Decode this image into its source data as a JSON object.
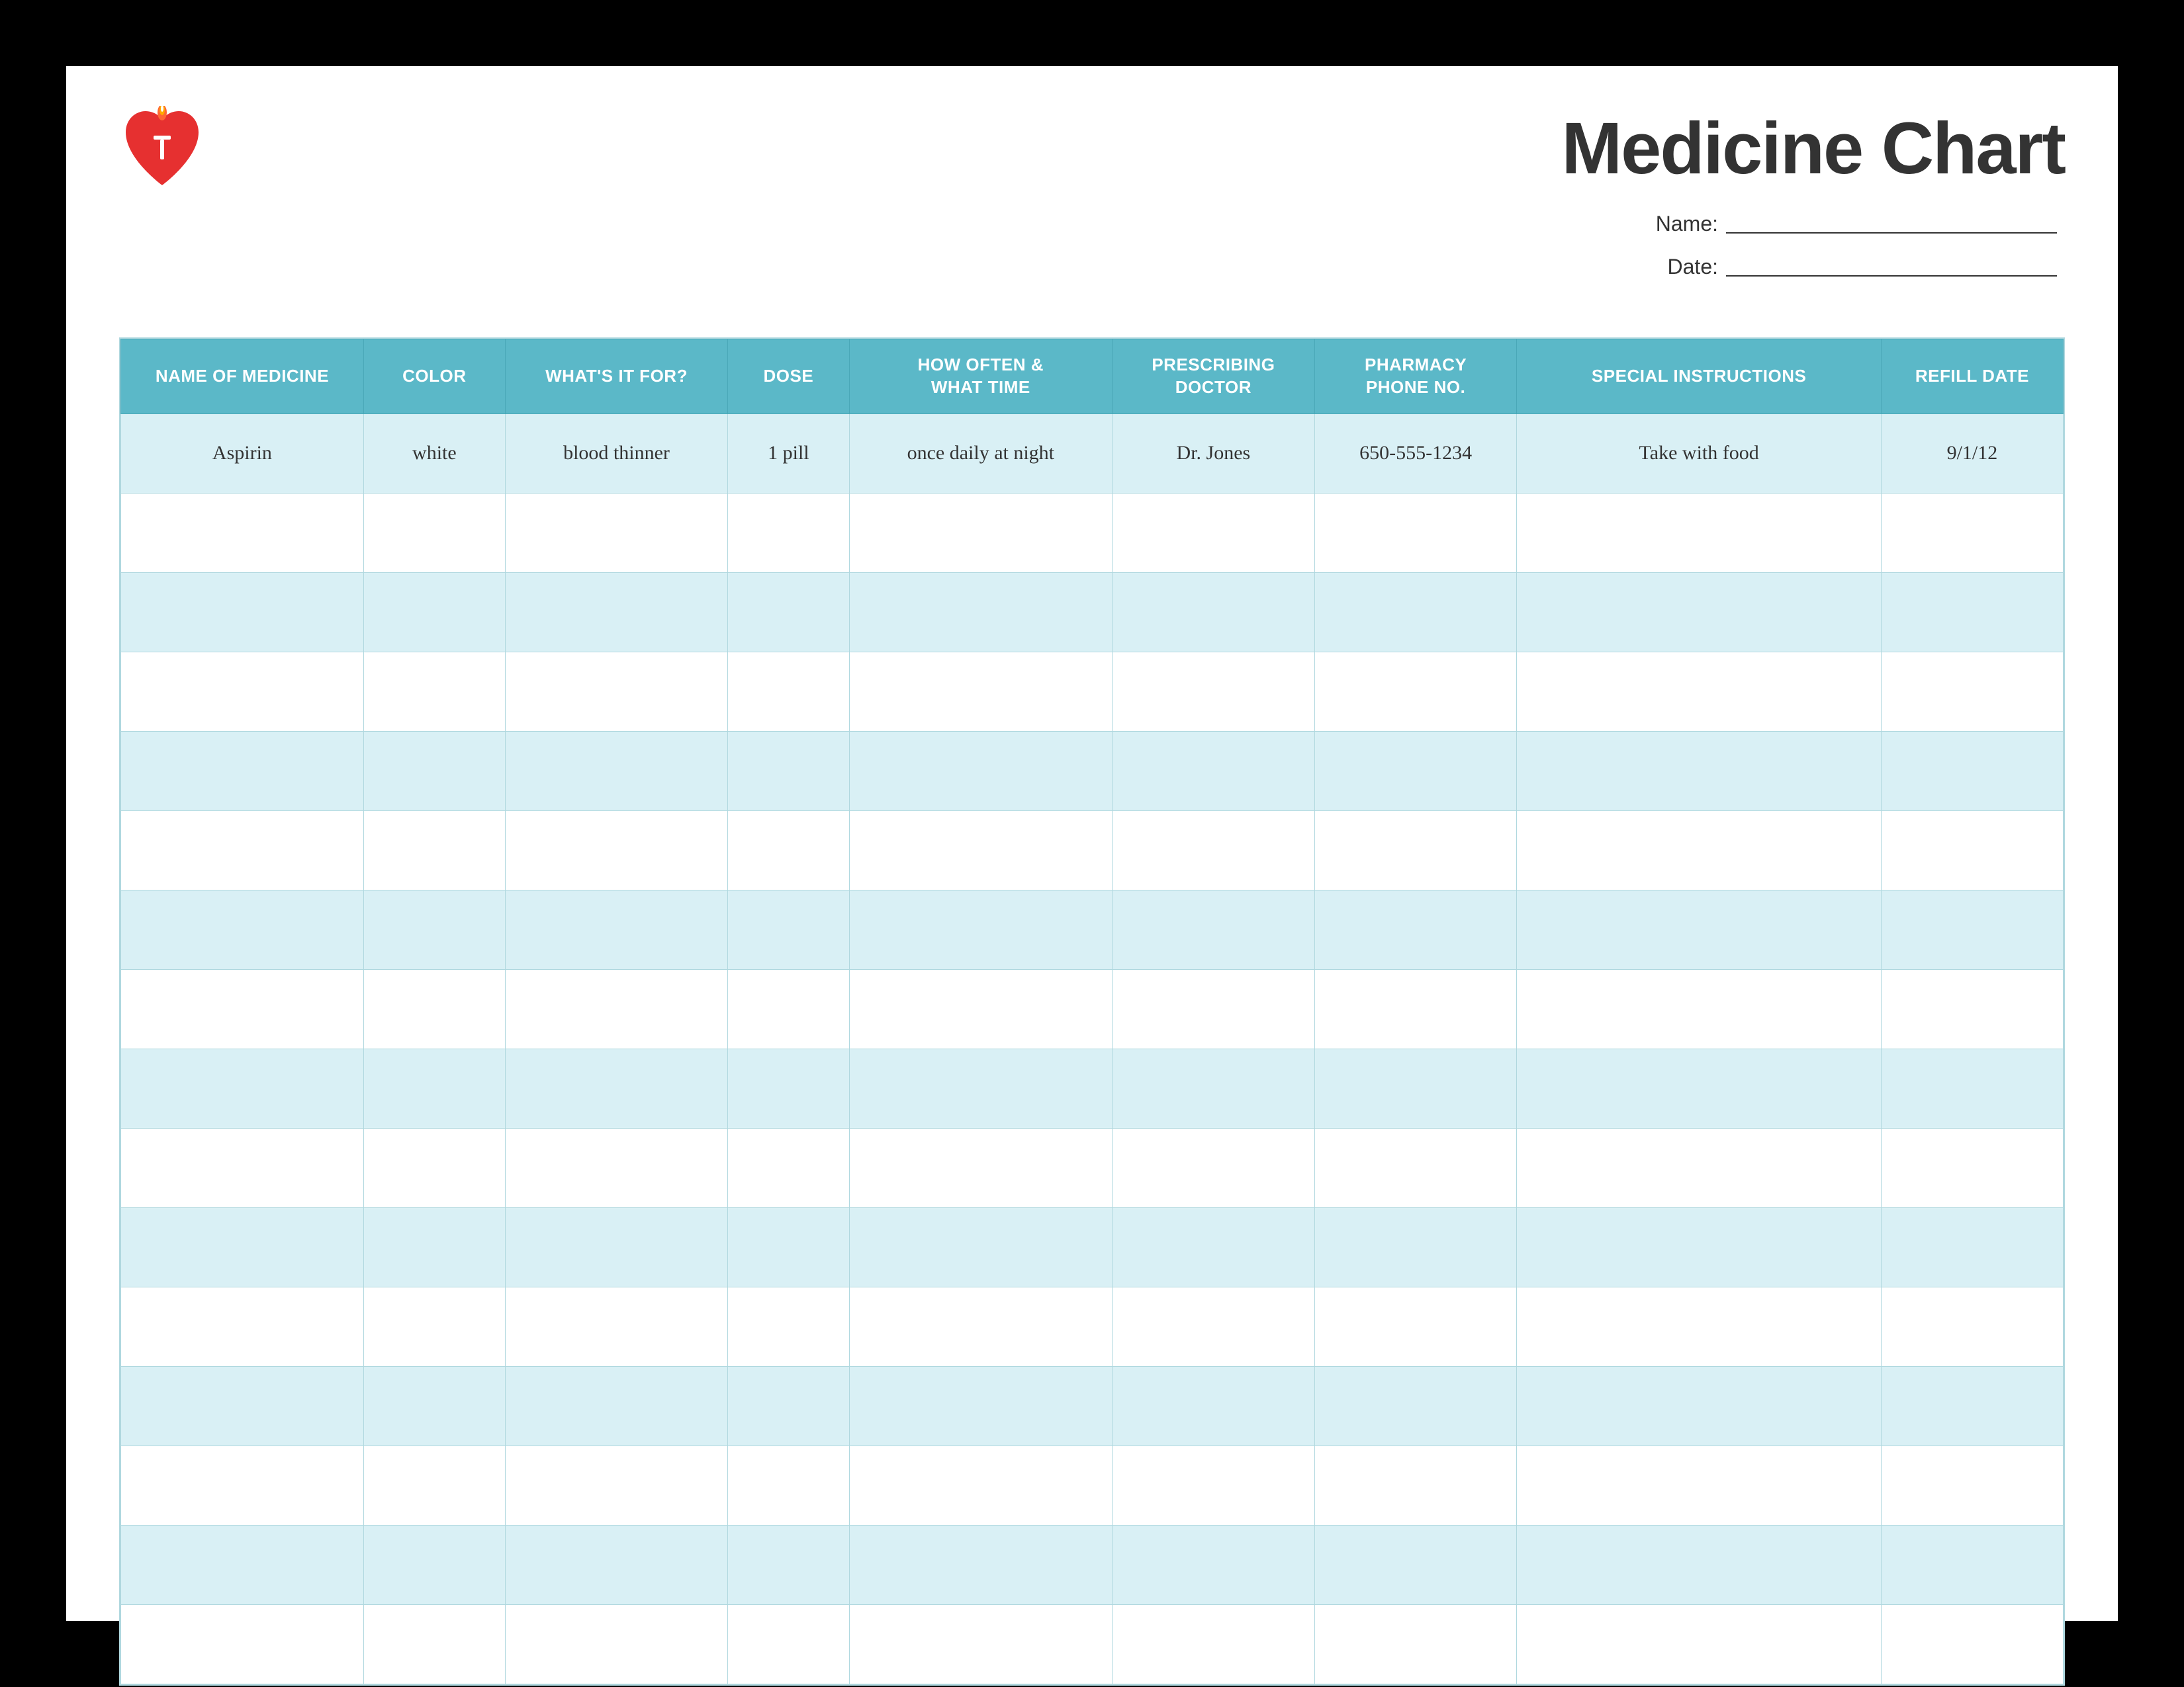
{
  "header": {
    "title": "Medicine Chart",
    "name_label": "Name:",
    "date_label": "Date:"
  },
  "table": {
    "columns": [
      {
        "id": "name",
        "label": "NAME OF MEDICINE"
      },
      {
        "id": "color",
        "label": "COLOR"
      },
      {
        "id": "what",
        "label": "WHAT'S IT FOR?"
      },
      {
        "id": "dose",
        "label": "DOSE"
      },
      {
        "id": "how",
        "label": "HOW OFTEN &\nWHAT TIME"
      },
      {
        "id": "doctor",
        "label": "PRESCRIBING\nDOCTOR"
      },
      {
        "id": "pharmacy",
        "label": "PHARMACY\nPHONE NO."
      },
      {
        "id": "special",
        "label": "SPECIAL INSTRUCTIONS"
      },
      {
        "id": "refill",
        "label": "REFILL DATE"
      }
    ],
    "rows": [
      {
        "name": "Aspirin",
        "color": "white",
        "what": "blood thinner",
        "dose": "1 pill",
        "how": "once daily at night",
        "doctor": "Dr. Jones",
        "pharmacy": "650-555-1234",
        "special": "Take with food",
        "refill": "9/1/12"
      },
      {
        "name": "",
        "color": "",
        "what": "",
        "dose": "",
        "how": "",
        "doctor": "",
        "pharmacy": "",
        "special": "",
        "refill": ""
      },
      {
        "name": "",
        "color": "",
        "what": "",
        "dose": "",
        "how": "",
        "doctor": "",
        "pharmacy": "",
        "special": "",
        "refill": ""
      },
      {
        "name": "",
        "color": "",
        "what": "",
        "dose": "",
        "how": "",
        "doctor": "",
        "pharmacy": "",
        "special": "",
        "refill": ""
      },
      {
        "name": "",
        "color": "",
        "what": "",
        "dose": "",
        "how": "",
        "doctor": "",
        "pharmacy": "",
        "special": "",
        "refill": ""
      },
      {
        "name": "",
        "color": "",
        "what": "",
        "dose": "",
        "how": "",
        "doctor": "",
        "pharmacy": "",
        "special": "",
        "refill": ""
      },
      {
        "name": "",
        "color": "",
        "what": "",
        "dose": "",
        "how": "",
        "doctor": "",
        "pharmacy": "",
        "special": "",
        "refill": ""
      },
      {
        "name": "",
        "color": "",
        "what": "",
        "dose": "",
        "how": "",
        "doctor": "",
        "pharmacy": "",
        "special": "",
        "refill": ""
      },
      {
        "name": "",
        "color": "",
        "what": "",
        "dose": "",
        "how": "",
        "doctor": "",
        "pharmacy": "",
        "special": "",
        "refill": ""
      },
      {
        "name": "",
        "color": "",
        "what": "",
        "dose": "",
        "how": "",
        "doctor": "",
        "pharmacy": "",
        "special": "",
        "refill": ""
      },
      {
        "name": "",
        "color": "",
        "what": "",
        "dose": "",
        "how": "",
        "doctor": "",
        "pharmacy": "",
        "special": "",
        "refill": ""
      },
      {
        "name": "",
        "color": "",
        "what": "",
        "dose": "",
        "how": "",
        "doctor": "",
        "pharmacy": "",
        "special": "",
        "refill": ""
      },
      {
        "name": "",
        "color": "",
        "what": "",
        "dose": "",
        "how": "",
        "doctor": "",
        "pharmacy": "",
        "special": "",
        "refill": ""
      },
      {
        "name": "",
        "color": "",
        "what": "",
        "dose": "",
        "how": "",
        "doctor": "",
        "pharmacy": "",
        "special": "",
        "refill": ""
      },
      {
        "name": "",
        "color": "",
        "what": "",
        "dose": "",
        "how": "",
        "doctor": "",
        "pharmacy": "",
        "special": "",
        "refill": ""
      },
      {
        "name": "",
        "color": "",
        "what": "",
        "dose": "",
        "how": "",
        "doctor": "",
        "pharmacy": "",
        "special": "",
        "refill": ""
      }
    ]
  }
}
